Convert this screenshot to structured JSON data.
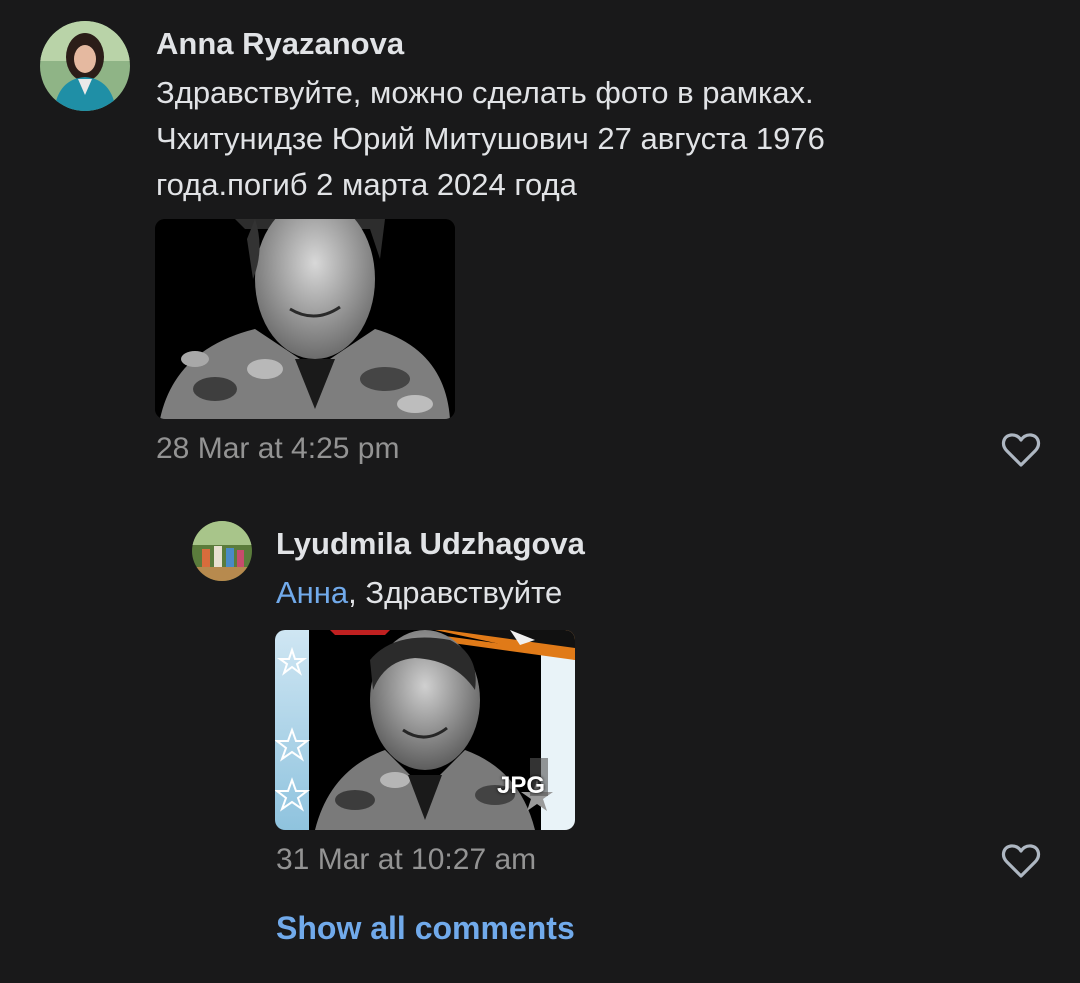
{
  "comments": [
    {
      "author": "Anna Ryazanova",
      "text_lines": [
        "Здравствуйте, можно сделать фото в рамках.",
        "Чхитунидзе Юрий Митушович 27 августа 1976",
        "года.погиб 2 марта 2024 года"
      ],
      "timestamp": "28 Mar at 4:25 pm",
      "like_icon": "heart-outline-icon"
    },
    {
      "author": "Lyudmila Udzhagova",
      "mention": "Анна",
      "text_rest": ", Здравствуйте",
      "attachment_badge": "JPG",
      "timestamp": "31 Mar at 10:27 am",
      "like_icon": "heart-outline-icon"
    }
  ],
  "show_all_label": "Show all comments",
  "colors": {
    "background": "#19191a",
    "text": "#e1e3e6",
    "secondary": "#939393",
    "accent": "#71aaeb"
  }
}
